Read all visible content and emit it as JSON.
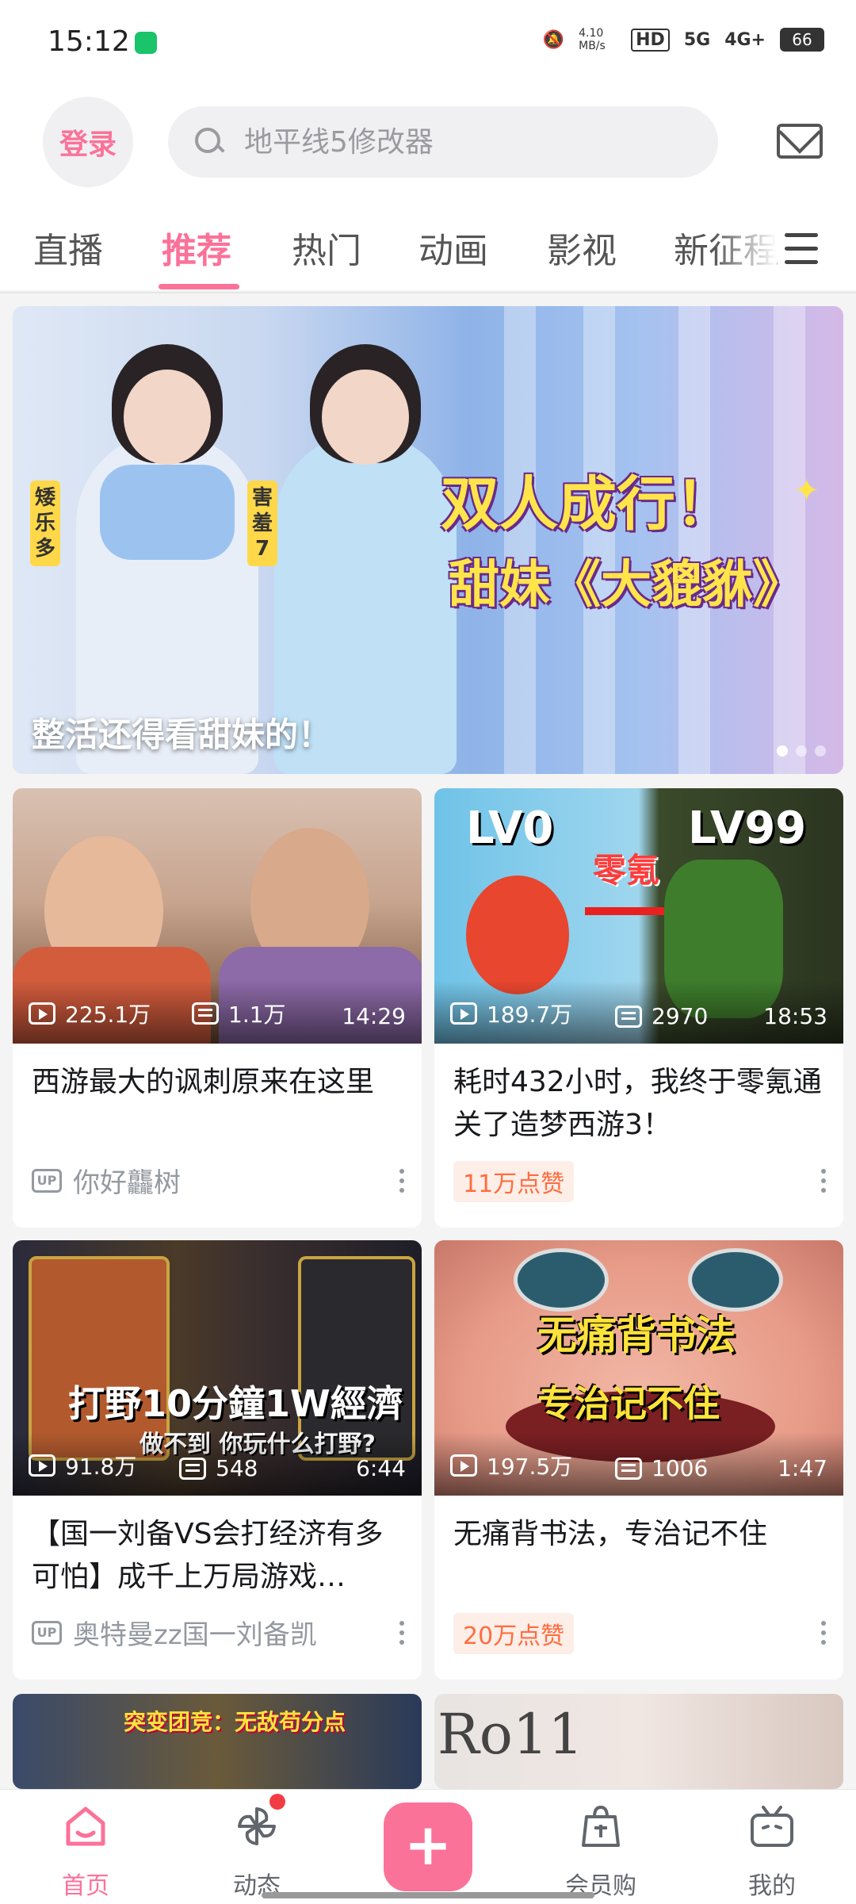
{
  "status_bar": {
    "time": "15:12",
    "speed": "4.10 MB/s",
    "hd": "HD",
    "net1": "5G",
    "net2": "4G+",
    "battery": "66"
  },
  "header": {
    "login_label": "登录",
    "search_placeholder": "地平线5修改器",
    "mail_icon": "mail-icon"
  },
  "tabs": [
    {
      "label": "直播"
    },
    {
      "label": "推荐"
    },
    {
      "label": "热门"
    },
    {
      "label": "动画"
    },
    {
      "label": "影视"
    },
    {
      "label": "新征程"
    }
  ],
  "active_tab_index": 1,
  "banner": {
    "caption": "整活还得看甜妹的！",
    "headline1": "双人成行！",
    "headline2": "甜妹《大貔貅》",
    "tag_left": "矮乐多",
    "tag_right": "害羞7",
    "dots": 3,
    "active_dot": 0
  },
  "cards": [
    {
      "views": "225.1万",
      "danmaku": "1.1万",
      "duration": "14:29",
      "title": "西游最大的讽刺原来在这里",
      "footer_type": "up",
      "footer": "你好龘树",
      "thumb_text": ""
    },
    {
      "views": "189.7万",
      "danmaku": "2970",
      "duration": "18:53",
      "title": "耗时432小时，我终于零氪通关了造梦西游3！",
      "footer_type": "badge",
      "footer": "11万点赞",
      "thumb_text_a": "LV0",
      "thumb_text_b": "LV99",
      "thumb_text_c": "零氪"
    },
    {
      "views": "91.8万",
      "danmaku": "548",
      "duration": "6:44",
      "title": "【国一刘备VS会打经济有多可怕】成千上万局游戏…",
      "footer_type": "up",
      "footer": "奥特曼zz国一刘备凯",
      "thumb_text_a": "打野10分鐘1W經濟",
      "thumb_text_b": "做不到 你玩什么打野?"
    },
    {
      "views": "197.5万",
      "danmaku": "1006",
      "duration": "1:47",
      "title": "无痛背书法，专治记不住",
      "footer_type": "badge",
      "footer": "20万点赞",
      "thumb_text_a": "无痛背书法",
      "thumb_text_b": "专治记不住"
    }
  ],
  "partial_cards": [
    {
      "thumb_text": "突变团竞：无敌苟分点"
    },
    {
      "thumb_text": "Ro11"
    }
  ],
  "bottom_nav": [
    {
      "label": "首页",
      "icon": "home-tv-icon"
    },
    {
      "label": "动态",
      "icon": "pinwheel-icon"
    },
    {
      "label": "",
      "icon": "plus-icon"
    },
    {
      "label": "会员购",
      "icon": "shopping-bag-icon"
    },
    {
      "label": "我的",
      "icon": "bilibili-tv-icon"
    }
  ],
  "colors": {
    "accent": "#fb7299",
    "badge_text": "#ff6d3f",
    "badge_bg": "#fdeee8"
  }
}
